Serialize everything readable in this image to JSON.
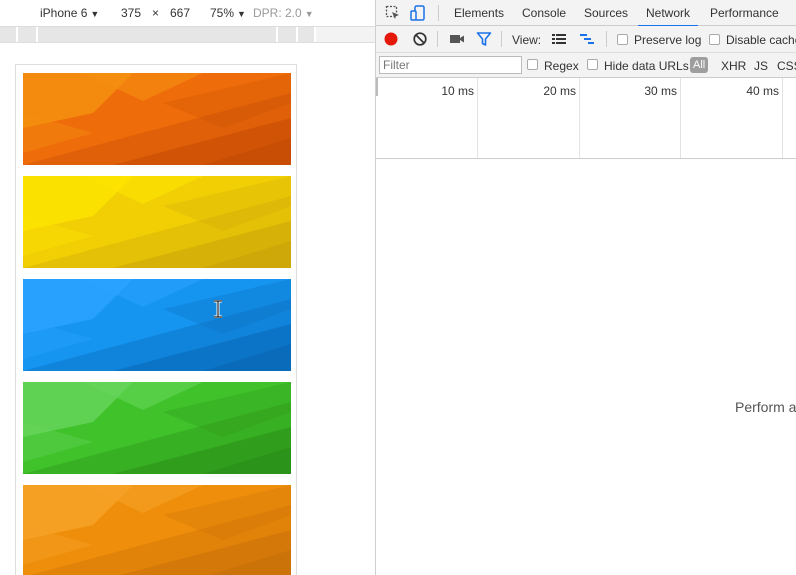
{
  "device_toolbar": {
    "device": "iPhone 6",
    "width": "375",
    "times": "×",
    "height": "667",
    "zoom": "75%",
    "dpr": "DPR: 2.0"
  },
  "cards": [
    {
      "name": "orange",
      "base": "#ef6c0a",
      "light": "#f5900f",
      "dark": "#c44b05"
    },
    {
      "name": "yellow",
      "base": "#f2cf05",
      "light": "#fde400",
      "dark": "#cba40a"
    },
    {
      "name": "blue",
      "base": "#1594f0",
      "light": "#2aa3ff",
      "dark": "#0a68b5"
    },
    {
      "name": "green",
      "base": "#3fc22a",
      "light": "#66d55a",
      "dark": "#2a8f18"
    },
    {
      "name": "amber",
      "base": "#ee8e0a",
      "light": "#f6a228",
      "dark": "#c8700a"
    }
  ],
  "devtools": {
    "tabs": [
      "Elements",
      "Console",
      "Sources",
      "Network",
      "Performance"
    ],
    "active_tab": "Network",
    "toolbar": {
      "view_label": "View:",
      "preserve_log": "Preserve log",
      "disable_cache": "Disable cache"
    },
    "filter": {
      "placeholder": "Filter",
      "regex": "Regex",
      "hide_data_urls": "Hide data URLs",
      "types": [
        "All",
        "XHR",
        "JS",
        "CSS"
      ]
    },
    "timeline_ticks": [
      "10 ms",
      "20 ms",
      "30 ms",
      "40 ms"
    ],
    "empty_message": "Perform a"
  },
  "colors": {
    "record": "#e5190b",
    "accent": "#1a73e8"
  }
}
